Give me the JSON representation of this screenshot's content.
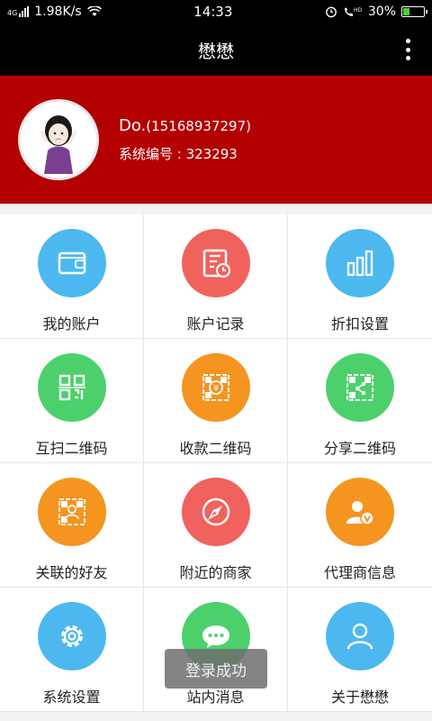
{
  "status": {
    "network": "4G",
    "speed": "1.98K/s",
    "time": "14:33",
    "battery": "30%",
    "battery_level": 0.3
  },
  "appbar": {
    "title": "懋懋"
  },
  "profile": {
    "name": "Do.",
    "phone": "(15168937297)",
    "code_label": "系统编号 : 323293"
  },
  "menu": {
    "items": [
      {
        "label": "我的账户",
        "icon": "wallet-icon",
        "color": "#4db8f0"
      },
      {
        "label": "账户记录",
        "icon": "ledger-icon",
        "color": "#f0625e"
      },
      {
        "label": "折扣设置",
        "icon": "bar-chart-icon",
        "color": "#4db8f0"
      },
      {
        "label": "互扫二维码",
        "icon": "qr-code-icon",
        "color": "#4cd06b"
      },
      {
        "label": "收款二维码",
        "icon": "yen-qr-icon",
        "color": "#f5941f"
      },
      {
        "label": "分享二维码",
        "icon": "share-qr-icon",
        "color": "#4cd06b"
      },
      {
        "label": "关联的好友",
        "icon": "friend-qr-icon",
        "color": "#f5941f"
      },
      {
        "label": "附近的商家",
        "icon": "compass-icon",
        "color": "#f0625e"
      },
      {
        "label": "代理商信息",
        "icon": "agent-icon",
        "color": "#f5941f"
      },
      {
        "label": "系统设置",
        "icon": "gear-icon",
        "color": "#4db8f0"
      },
      {
        "label": "站内消息",
        "icon": "chat-icon",
        "color": "#4cd06b"
      },
      {
        "label": "关于懋懋",
        "icon": "user-outline-icon",
        "color": "#4db8f0"
      }
    ]
  },
  "toast": {
    "text": "登录成功"
  }
}
